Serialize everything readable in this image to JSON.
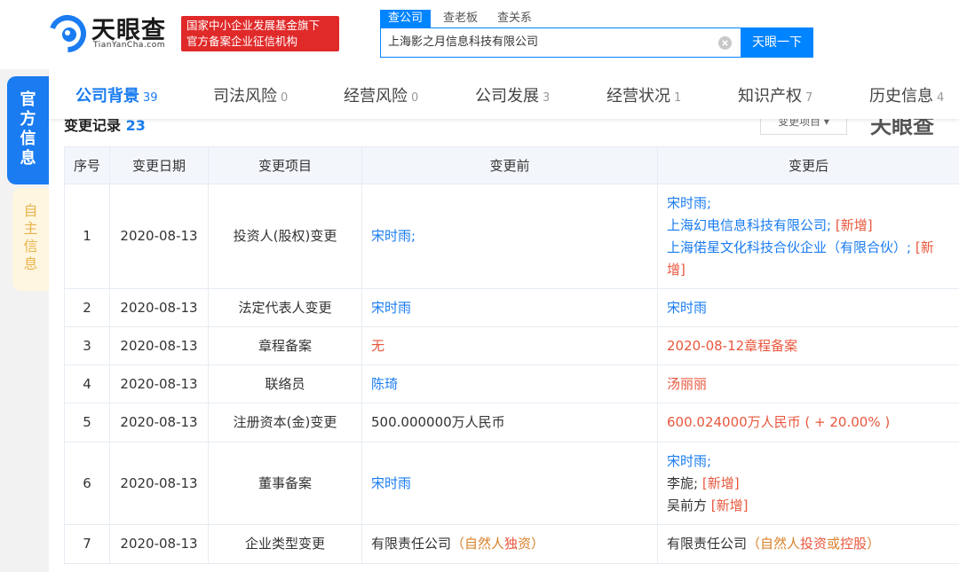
{
  "header": {
    "logo_text": "天眼查",
    "logo_sub": "TianYanCha.com",
    "badge_line1": "国家中小企业发展基金旗下",
    "badge_line2": "官方备案企业征信机构",
    "search_tabs": [
      "查公司",
      "查老板",
      "查关系"
    ],
    "search_value": "上海影之月信息科技有限公司",
    "search_button": "天眼一下"
  },
  "sidebar": {
    "official": [
      "官",
      "方",
      "信",
      "息"
    ],
    "self": [
      "自",
      "主",
      "信",
      "息"
    ]
  },
  "nav": [
    {
      "label": "公司背景",
      "count": "39"
    },
    {
      "label": "司法风险",
      "count": "0"
    },
    {
      "label": "经营风险",
      "count": "0"
    },
    {
      "label": "公司发展",
      "count": "3"
    },
    {
      "label": "经营状况",
      "count": "1"
    },
    {
      "label": "知识产权",
      "count": "7"
    },
    {
      "label": "历史信息",
      "count": "4"
    }
  ],
  "section": {
    "title": "变更记录",
    "count": "23",
    "filter": "变更项目 ▾",
    "watermark": "天眼查"
  },
  "table": {
    "headers": [
      "序号",
      "变更日期",
      "变更项目",
      "变更前",
      "变更后"
    ],
    "rows": [
      {
        "no": "1",
        "date": "2020-08-13",
        "item": "投资人(股权)变更"
      },
      {
        "no": "2",
        "date": "2020-08-13",
        "item": "法定代表人变更"
      },
      {
        "no": "3",
        "date": "2020-08-13",
        "item": "章程备案"
      },
      {
        "no": "4",
        "date": "2020-08-13",
        "item": "联络员"
      },
      {
        "no": "5",
        "date": "2020-08-13",
        "item": "注册资本(金)变更"
      },
      {
        "no": "6",
        "date": "2020-08-13",
        "item": "董事备案"
      },
      {
        "no": "7",
        "date": "2020-08-13",
        "item": "企业类型变更"
      }
    ],
    "r1_before": "宋时雨;",
    "r1_after_a": "宋时雨;",
    "r1_after_b": "上海幻电信息科技有限公司;",
    "r1_after_b_tag": "[新增]",
    "r1_after_c": "上海偌星文化科技合伙企业（有限合伙）;",
    "r1_after_c_tag1": "[新",
    "r1_after_c_tag2": "增]",
    "r2_before": "宋时雨",
    "r2_after": "宋时雨",
    "r3_before": "无",
    "r3_after": "2020-08-12章程备案",
    "r4_before": "陈琦",
    "r4_after": "汤丽丽",
    "r5_before": "500.000000万人民币",
    "r5_after": "600.024000万人民币 ( + 20.00% )",
    "r6_before": "宋时雨",
    "r6_after_a": "宋时雨;",
    "r6_after_b": "李旎;",
    "r6_after_b_tag": "[新增]",
    "r6_after_c": "吴前方",
    "r6_after_c_tag": "[新增]",
    "r7_before_a": "有限责任公司",
    "r7_before_b": "（自然人",
    "r7_before_c": "独",
    "r7_before_d": "资）",
    "r7_after_a": "有限责任公司",
    "r7_after_b": "（自然人",
    "r7_after_c": "投资",
    "r7_after_d": "或",
    "r7_after_e": "控股",
    "r7_after_f": "）"
  },
  "colors": {
    "accent": "#1a7cf0",
    "search_blue": "#0084ff",
    "badge_red": "#e02a2a",
    "change_red": "#e8573d"
  }
}
